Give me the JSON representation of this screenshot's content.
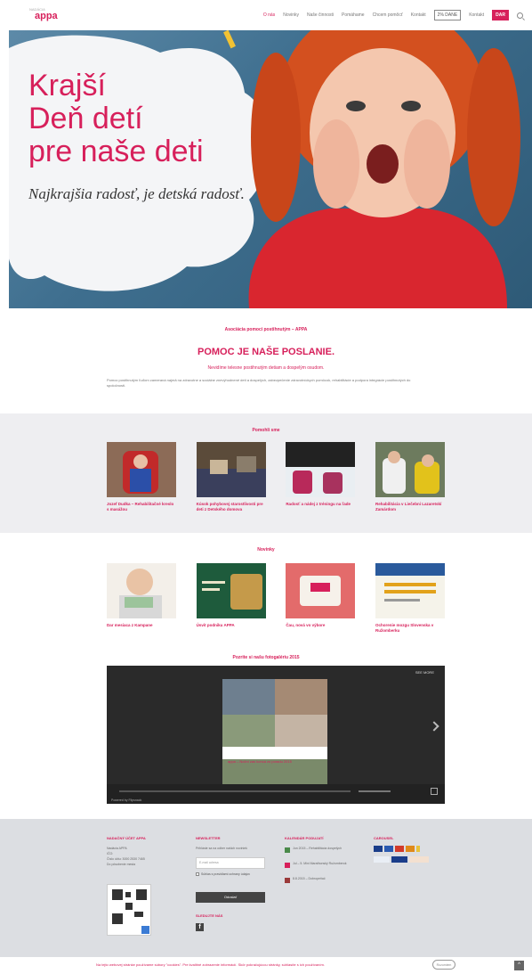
{
  "header": {
    "logo": {
      "pre": "NADÁCIA",
      "name": "appa"
    },
    "nav": [
      "O nás",
      "Novinky",
      "Naše činnosti",
      "Pomáhame",
      "Chcem pomôcť",
      "Kontakt",
      "2% DANE",
      "Kontakt",
      "DAR"
    ]
  },
  "hero": {
    "title_line1": "Krajší",
    "title_line2": "Deň detí",
    "title_line3": "pre naše deti",
    "subtitle": "Najkrajšia radosť, je detská radosť."
  },
  "about": {
    "small": "Asociácia pomoci postihnutým – APPA",
    "title": "POMOC JE NAŠE POSLANIE.",
    "subtitle": "Nevidíme telesne postihnutým detiam a dospelým osudom.",
    "body": "Pomoc postihnutým ľuďom zameraná najmä na zdravotne a sociálne znevýhodnené deti a dospelých, zabezpečenie zdravotníckych pomôcok, rehabilitácie a podpora integrácie postihnutých do spoločnosti."
  },
  "helped": {
    "title": "Pomohli sme",
    "cards": [
      {
        "caption": "Jozef Dudka – Rehabilitačné kreslo s masážou"
      },
      {
        "caption": "Kúsok pohybovej starostlivosti pre deti z Detského domova"
      },
      {
        "caption": "Radosť a nádej z tréningu na ľade"
      },
      {
        "caption": "Rehabilitácia v Liečebni Lazaretskí Zamárdom"
      }
    ]
  },
  "news": {
    "title": "Novinky",
    "cards": [
      {
        "caption": "Dar mesiaca z Kampane"
      },
      {
        "caption": "Úsvit podniku APPA"
      },
      {
        "caption": "Čau, nová vo výbore"
      },
      {
        "caption": "Ochorenie mozgu Slovenska v Ružomberku"
      }
    ]
  },
  "video": {
    "title": "Pozrite si našu fotogalériu 2015",
    "brand": "SEE MORE",
    "poster_caption": "appa – Noční zas konca zo poradu 2015",
    "powered": "Powered by Flipsnack"
  },
  "footer": {
    "col1": {
      "title": "NADAČNÝ ÚČET APPA",
      "lines": [
        "Nadácia APPA",
        "IČO:",
        "Číslo účtu: 3000 2530 7465",
        "Do pôsobenie mesta"
      ]
    },
    "col2": {
      "title": "NEWSLETTER",
      "text": "Prihláste sa na odber našich noviniek",
      "placeholder": "E-mail adresa",
      "consent": "Súhlas s pravidlami ochrany údajov",
      "button": "Odoslať"
    },
    "col2b": {
      "title": "SLEDUJTE NÁS"
    },
    "col3": {
      "title": "KALENDÁR PODUJATÍ",
      "items": [
        "Jun 2015 – Rehabilitácia dospelých",
        "Jul – 5. Mini Marathonský Ružomberok",
        "8.8.2015 – Dobropeňač"
      ]
    },
    "col4": {
      "title": "CAROUSEL"
    }
  },
  "cookie": {
    "message": "Na tejto webovej stránke používame súbory \"cookies\". Pre kvalitné zobrazenie informácií. Skôr pokračujúcou stránky, súhlasíte s ich používaním.",
    "button": "Rozumiem",
    "up": "^"
  }
}
